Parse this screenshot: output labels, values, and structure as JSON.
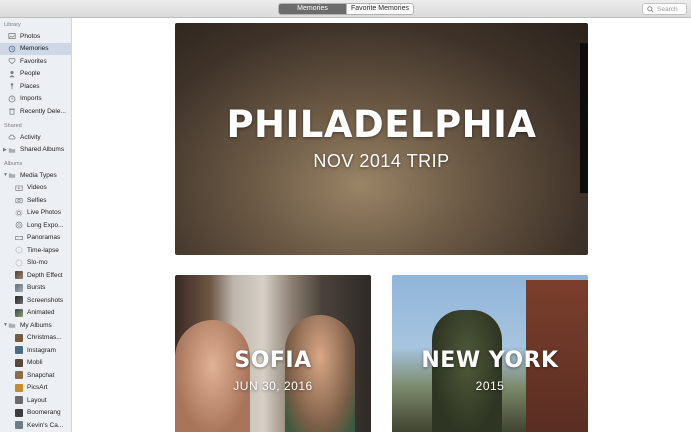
{
  "toolbar": {
    "tabs": [
      {
        "label": "Memories",
        "active": true
      },
      {
        "label": "Favorite Memories",
        "active": false
      }
    ],
    "search_placeholder": "Search"
  },
  "sidebar": {
    "library_header": "Library",
    "library": [
      {
        "label": "Photos",
        "icon": "photos-icon"
      },
      {
        "label": "Memories",
        "icon": "memories-icon",
        "selected": true
      },
      {
        "label": "Favorites",
        "icon": "heart-icon"
      },
      {
        "label": "People",
        "icon": "person-icon"
      },
      {
        "label": "Places",
        "icon": "pin-icon"
      },
      {
        "label": "Imports",
        "icon": "clock-icon"
      },
      {
        "label": "Recently Dele...",
        "icon": "trash-icon"
      }
    ],
    "shared_header": "Shared",
    "shared": [
      {
        "label": "Activity",
        "icon": "cloud-icon"
      },
      {
        "label": "Shared Albums",
        "icon": "folder-icon"
      }
    ],
    "albums_header": "Albums",
    "media_types_label": "Media Types",
    "media_types": [
      {
        "label": "Videos",
        "icon": "video-icon"
      },
      {
        "label": "Selfies",
        "icon": "camera-icon"
      },
      {
        "label": "Live Photos",
        "icon": "live-photo-icon"
      },
      {
        "label": "Long Expo...",
        "icon": "long-exposure-icon"
      },
      {
        "label": "Panoramas",
        "icon": "panorama-icon"
      },
      {
        "label": "Time-lapse",
        "icon": "time-lapse-icon"
      },
      {
        "label": "Slo-mo",
        "icon": "slo-mo-icon"
      },
      {
        "label": "Depth Effect",
        "icon": "depth-thumbnail"
      },
      {
        "label": "Bursts",
        "icon": "bursts-thumbnail"
      },
      {
        "label": "Screenshots",
        "icon": "screenshots-thumbnail"
      },
      {
        "label": "Animated",
        "icon": "animated-thumbnail"
      }
    ],
    "my_albums_label": "My Albums",
    "my_albums": [
      {
        "label": "Christmas...",
        "color": "#7a5a3c"
      },
      {
        "label": "Instagram",
        "color": "#4a6a86"
      },
      {
        "label": "Mobli",
        "color": "#5b4a3a"
      },
      {
        "label": "Snapchat",
        "color": "#8a6d4a"
      },
      {
        "label": "PicsArt",
        "color": "#c98a2a"
      },
      {
        "label": "Layout",
        "color": "#6a6a6a"
      },
      {
        "label": "Boomerang",
        "color": "#3d3d3d"
      },
      {
        "label": "Kevin's Ca...",
        "color": "#6d7d8a"
      }
    ]
  },
  "memories": [
    {
      "title": "PHILADELPHIA",
      "subtitle": "NOV 2014 TRIP"
    },
    {
      "title": "SOFIA",
      "subtitle": "JUN 30, 2016"
    },
    {
      "title": "NEW YORK",
      "subtitle": "2015"
    }
  ],
  "colors": {
    "sidebar_bg": "#eceff3",
    "selection": "#cdd7e6",
    "icon_tint": "#7a7d82"
  }
}
